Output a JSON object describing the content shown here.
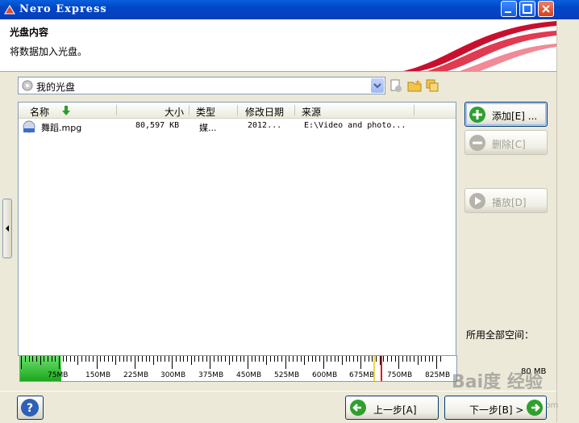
{
  "window": {
    "title": "Nero Express"
  },
  "header": {
    "title": "光盘内容",
    "subtitle": "将数据加入光盘。"
  },
  "disc_selector": {
    "value": "我的光盘"
  },
  "file_list": {
    "columns": [
      "名称",
      "大小",
      "类型",
      "修改日期",
      "来源"
    ],
    "rows": [
      {
        "name": "舞蹈.mpg",
        "size": "80,597 KB",
        "type": "媒...",
        "modified": "2012...",
        "source": "E:\\Video and photo..."
      }
    ]
  },
  "side_buttons": {
    "add": "添加[E] ...",
    "delete": "删除[C]",
    "play": "播放[D]"
  },
  "space_label": "所用全部空间：",
  "capacity": {
    "used_mb": 80,
    "used_label": "80 MB",
    "max_mb": 825,
    "tick_labels": [
      "75MB",
      "150MB",
      "225MB",
      "300MB",
      "375MB",
      "450MB",
      "525MB",
      "600MB",
      "675MB",
      "750MB",
      "825MB"
    ]
  },
  "nav": {
    "back": "上一步[A]",
    "next": "下一步[B] >"
  },
  "watermark": {
    "main": "Bai度 经验",
    "sub": "jingyan.baidu.com"
  },
  "colors": {
    "title_blue": "#0a5fdc",
    "fill_green": "#1ba61b",
    "ribbon_red": "#c8102e"
  }
}
